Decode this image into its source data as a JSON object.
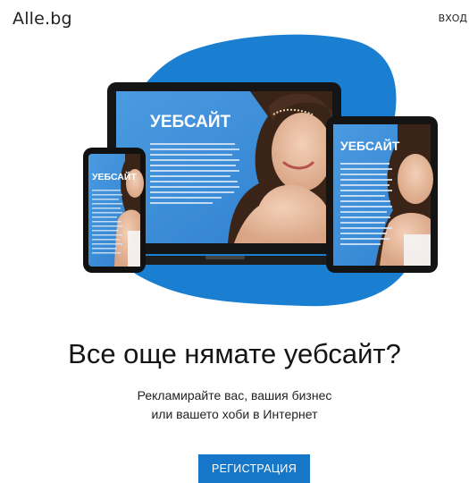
{
  "header": {
    "logo": "Alle.bg",
    "login_label": "ВХОД"
  },
  "hero": {
    "laptop_title": "УЕБСАЙТ",
    "tablet_title": "УЕБСАЙТ",
    "phone_title": "УЕБСАЙТ",
    "blob_color": "#1a7fd1",
    "screen_color": "#3f8fd8"
  },
  "main": {
    "headline": "Все още нямате уебсайт?",
    "subtitle_line1": "Рекламирайте вас, вашия бизнес",
    "subtitle_line2": "или вашето хоби в Интернет",
    "register_label": "РЕГИСТРАЦИЯ"
  }
}
